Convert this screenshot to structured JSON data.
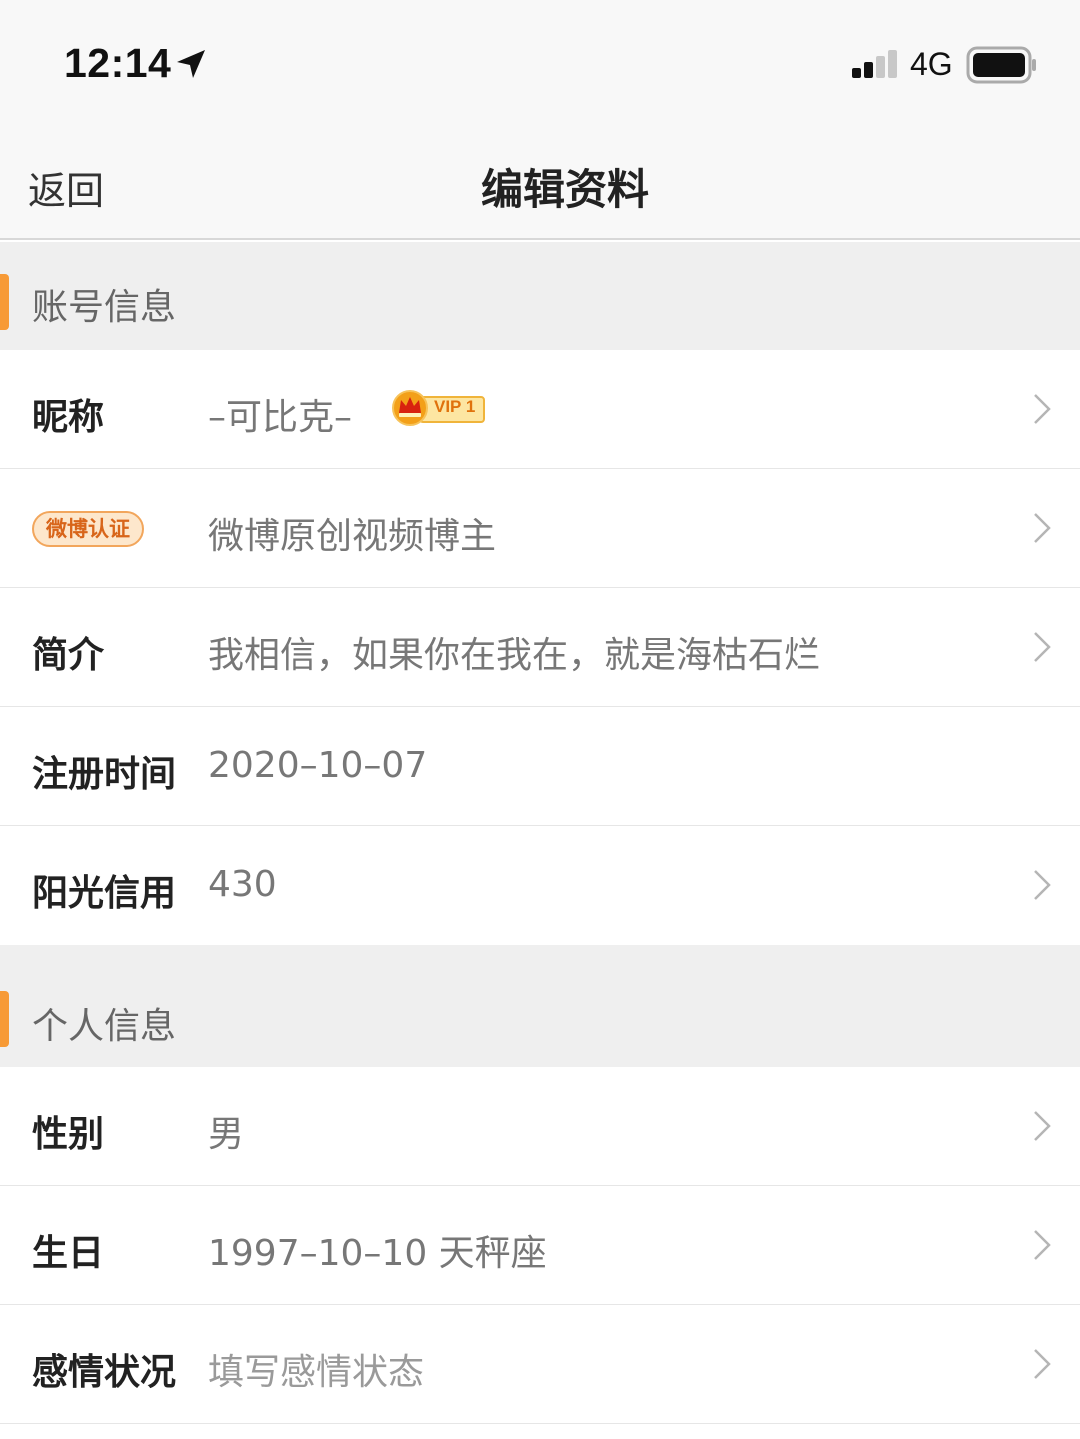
{
  "status_bar": {
    "time": "12:14",
    "network": "4G",
    "icons": [
      "location-arrow-icon",
      "signal-icon",
      "battery-icon"
    ]
  },
  "nav": {
    "back_label": "返回",
    "title": "编辑资料"
  },
  "sections": {
    "account": {
      "title": "账号信息",
      "rows": {
        "nickname": {
          "label": "昵称",
          "value": "–可比克–",
          "vip": "VIP 1"
        },
        "verified": {
          "badge": "微博认证",
          "value": "微博原创视频博主"
        },
        "bio": {
          "label": "简介",
          "value": "我相信，如果你在我在，就是海枯石烂"
        },
        "register": {
          "label": "注册时间",
          "value": "2020–10–07"
        },
        "credit": {
          "label": "阳光信用",
          "value": "430"
        }
      }
    },
    "personal": {
      "title": "个人信息",
      "rows": {
        "gender": {
          "label": "性别",
          "value": "男"
        },
        "birthday": {
          "label": "生日",
          "value": "1997–10–10 天秤座"
        },
        "relationship": {
          "label": "感情状况",
          "value": "填写感情状态"
        }
      }
    }
  },
  "colors": {
    "accent": "#f79a36",
    "section_bg": "#efefef",
    "bar_bg": "#f8f8f8"
  }
}
